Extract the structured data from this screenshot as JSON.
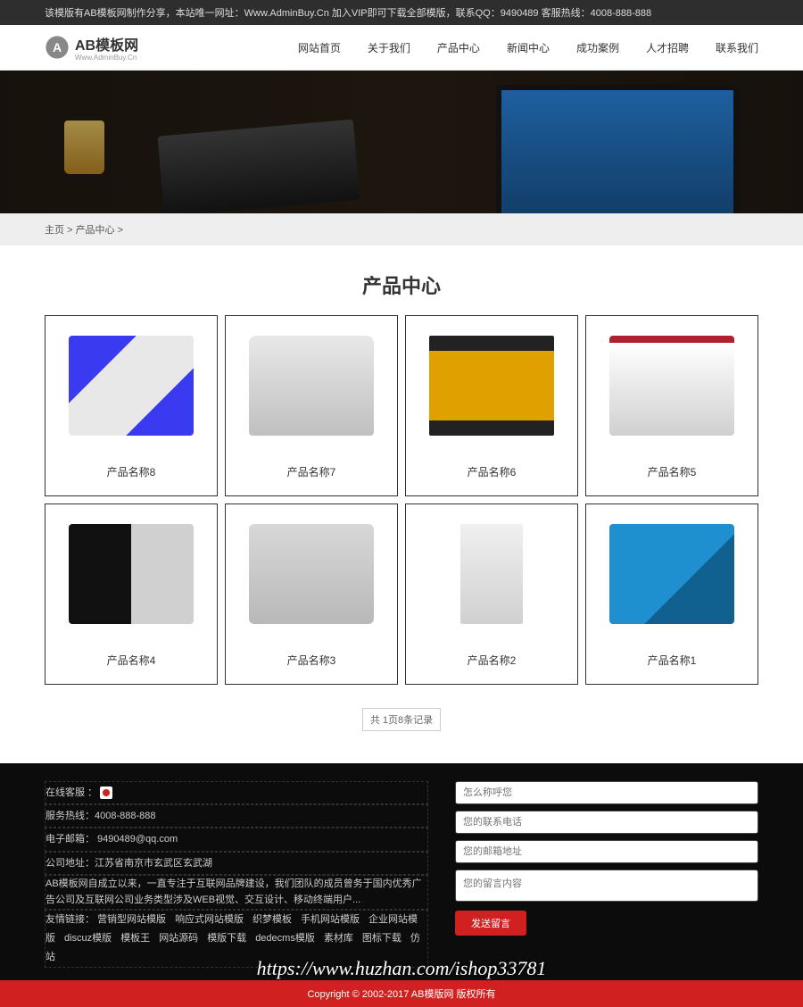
{
  "topbar": {
    "text": "该模版有AB模板网制作分享，本站唯一网址：Www.AdminBuy.Cn 加入VIP即可下载全部模版，联系QQ：9490489   客服热线：4008-888-888"
  },
  "logo": {
    "main": "AB模板网",
    "sub": "Www.AdminBuy.Cn"
  },
  "nav": [
    "网站首页",
    "关于我们",
    "产品中心",
    "新闻中心",
    "成功案例",
    "人才招聘",
    "联系我们"
  ],
  "breadcrumb": {
    "home": "主页",
    "sep": ">",
    "current": "产品中心",
    "tail": ">"
  },
  "pageTitle": "产品中心",
  "products": [
    {
      "name": "产品名称8",
      "cls": "p1"
    },
    {
      "name": "产品名称7",
      "cls": "p2"
    },
    {
      "name": "产品名称6",
      "cls": "p3"
    },
    {
      "name": "产品名称5",
      "cls": "p4"
    },
    {
      "name": "产品名称4",
      "cls": "p5"
    },
    {
      "name": "产品名称3",
      "cls": "p6"
    },
    {
      "name": "产品名称2",
      "cls": "p7"
    },
    {
      "name": "产品名称1",
      "cls": "p8"
    }
  ],
  "pager": {
    "text": "共 1页8条记录"
  },
  "footer": {
    "onlineService": "在线客服 ：",
    "hotline": "服务热线：4008-888-888",
    "email": "电子邮箱： 9490489@qq.com",
    "address": "公司地址：江苏省南京市玄武区玄武湖",
    "desc": "AB模板网自成立以来，一直专注于互联网品牌建设，我们团队的成员曾务于国内优秀广告公司及互联网公司业务类型涉及WEB视觉、交互设计、移动终端用户...",
    "linksLabel": "友情链接：",
    "links": [
      "营销型网站模版",
      "响应式网站模版",
      "织梦模板",
      "手机网站模版",
      "企业网站模版",
      "discuz模版",
      "模板王",
      "网站源码",
      "模版下载",
      "dedecms模版",
      "素材库",
      "图标下载",
      "仿站"
    ]
  },
  "form": {
    "namePh": "怎么称呼您",
    "phonePh": "您的联系电话",
    "emailPh": "您的邮箱地址",
    "msgPh": "您的留言内容",
    "submit": "发送留言"
  },
  "copyright": "Copyright © 2002-2017 AB模版网 版权所有",
  "watermark": "https://www.huzhan.com/ishop33781"
}
